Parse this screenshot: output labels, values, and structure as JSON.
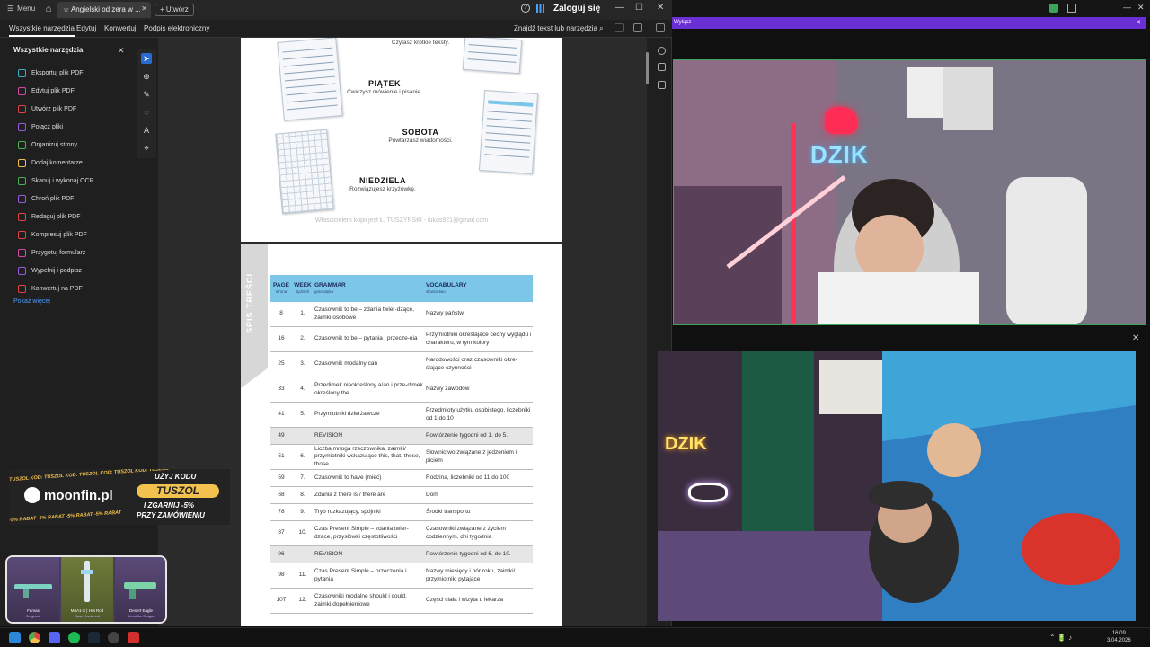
{
  "titlebar": {
    "menu_label": "Menu",
    "tab_title": "Angielski od zera w ...",
    "new_label": "Utwórz",
    "signin_label": "Zaloguj się"
  },
  "toolbar": {
    "tabs": [
      "Wszystkie narzędzia",
      "Edytuj",
      "Konwertuj",
      "Podpis elektroniczny"
    ],
    "find_label": "Znajdź tekst lub narzędzia"
  },
  "sidebar": {
    "heading": "Wszystkie narzędzia",
    "items": [
      {
        "label": "Eksportuj plik PDF",
        "color": "#3ab0c8"
      },
      {
        "label": "Edytuj plik PDF",
        "color": "#d94aa8"
      },
      {
        "label": "Utwórz plik PDF",
        "color": "#e0443e"
      },
      {
        "label": "Połącz pliki",
        "color": "#9b59e0"
      },
      {
        "label": "Organizuj strony",
        "color": "#4cb050"
      },
      {
        "label": "Dodaj komentarze",
        "color": "#f2c14e"
      },
      {
        "label": "Skanuj i wykonaj OCR",
        "color": "#4cb050"
      },
      {
        "label": "Chroń plik PDF",
        "color": "#9b59e0"
      },
      {
        "label": "Redaguj plik PDF",
        "color": "#e0443e"
      },
      {
        "label": "Kompresuj plik PDF",
        "color": "#e0443e"
      },
      {
        "label": "Przygotuj formularz",
        "color": "#d94aa8"
      },
      {
        "label": "Wypełnij i podpisz",
        "color": "#9b59e0"
      },
      {
        "label": "Konwertuj na PDF",
        "color": "#e0443e"
      }
    ],
    "more_label": "Pokaż więcej"
  },
  "page1": {
    "schedule": [
      {
        "day": "",
        "text": "Czytasz krótkie teksty."
      },
      {
        "day": "PIĄTEK",
        "text": "Ćwiczysz mówienie i pisanie."
      },
      {
        "day": "SOBOTA",
        "text": "Powtarzasz wiadomości."
      },
      {
        "day": "NIEDZIELA",
        "text": "Rozwiązujesz krzyżówkę."
      }
    ],
    "watermark": "Właścicielem kopii jest Ł. TUSZYŃSKI - lukas921@gmail.com"
  },
  "page2": {
    "side_label": "SPIS TREŚCI",
    "columns": [
      {
        "title": "PAGE",
        "sub": "strona"
      },
      {
        "title": "WEEK",
        "sub": "tydzień"
      },
      {
        "title": "GRAMMAR",
        "sub": "gramatyka"
      },
      {
        "title": "VOCABULARY",
        "sub": "słownictwo"
      }
    ],
    "rows": [
      {
        "page": "8",
        "week": "1.",
        "grammar": "Czasownik to be – zdania twier-dzące, zaimki osobowe",
        "vocab": "Nazwy państw",
        "rev": false
      },
      {
        "page": "16",
        "week": "2.",
        "grammar": "Czasownik to be – pytania i przecze-nia",
        "vocab": "Przymiotniki określające cechy wyglądu i charakteru, w tym kolory",
        "rev": false
      },
      {
        "page": "25",
        "week": "3.",
        "grammar": "Czasownik modalny can",
        "vocab": "Narodowości oraz czasowniki okre-ślające czynności",
        "rev": false
      },
      {
        "page": "33",
        "week": "4.",
        "grammar": "Przedimek nieokreślony a/an i prze-dimek określony the",
        "vocab": "Nazwy zawodów",
        "rev": false
      },
      {
        "page": "41",
        "week": "5.",
        "grammar": "Przymiotniki dzierżawcze",
        "vocab": "Przedmioty użytku osobistego, liczebniki od 1 do 10",
        "rev": false
      },
      {
        "page": "49",
        "week": "",
        "grammar": "REVISION",
        "vocab": "Powtórzenie tygodni od 1. do 5.",
        "rev": true
      },
      {
        "page": "51",
        "week": "6.",
        "grammar": "Liczba mnoga rzeczownika, zaimki/ przymiotniki wskazujące this, that, these, those",
        "vocab": "Słownictwo związane z jedzeniem i piciem",
        "rev": false
      },
      {
        "page": "59",
        "week": "7.",
        "grammar": "Czasownik to have (mieć)",
        "vocab": "Rodzina, liczebniki od 11 do 100",
        "rev": false
      },
      {
        "page": "68",
        "week": "8.",
        "grammar": "Zdania z there is / there are",
        "vocab": "Dom",
        "rev": false
      },
      {
        "page": "78",
        "week": "9.",
        "grammar": "Tryb rozkazujący, spójniki",
        "vocab": "Środki transportu",
        "rev": false
      },
      {
        "page": "87",
        "week": "10.",
        "grammar": "Czas Present Simple – zdania twier-dzące, przysłówki częstotliwości",
        "vocab": "Czasowniki związane z życiem codziennym, dni tygodnia",
        "rev": false
      },
      {
        "page": "96",
        "week": "",
        "grammar": "REVISION",
        "vocab": "Powtórzenie tygodni od 6. do 10.",
        "rev": true
      },
      {
        "page": "98",
        "week": "11.",
        "grammar": "Czas Present Simple – przeczenia i pytania",
        "vocab": "Nazwy miesięcy i pór roku, zaimki/ przymiotniki pytające",
        "rev": false
      },
      {
        "page": "107",
        "week": "12.",
        "grammar": "Czasowniki modalne should i could, zaimki dopełnieniowe",
        "vocab": "Części ciała i wizyta u lekarza",
        "rev": false
      }
    ]
  },
  "promo": {
    "marquee_top": "TUSZOL KOD: TUSZOL KOD: TUSZOL KOD: TUSZOL KOD: TUSZOL",
    "brand": "moonfin.pl",
    "use_code": "UŻYJ KODU",
    "code": "TUSZOL",
    "line2": "I ZGARNIJ -5%",
    "line3": "PRZY ZAMÓWIENIU",
    "marquee_bottom": "-5% RABAT -5% RABAT -5% RABAT -5% RABAT"
  },
  "skins": [
    {
      "name": "Famas",
      "sub": "Sergeant"
    },
    {
      "name": "M4A1-S | Hot Rod",
      "sub": "Case Hardened"
    },
    {
      "name": "Desert Eagle",
      "sub": "Sunstrike Dragon"
    }
  ],
  "overlay": {
    "banner_label": "Wyłącz",
    "brand_sign": "DZIK",
    "brand_sign_2": "DZIK"
  },
  "clock": {
    "time": "16:09",
    "date": "3.04.2026"
  },
  "colors": {
    "accent": "#2a6bd1",
    "toc_header": "#7cc6ea",
    "banner": "#6b2fd6",
    "promo_yellow": "#f2c14e"
  }
}
